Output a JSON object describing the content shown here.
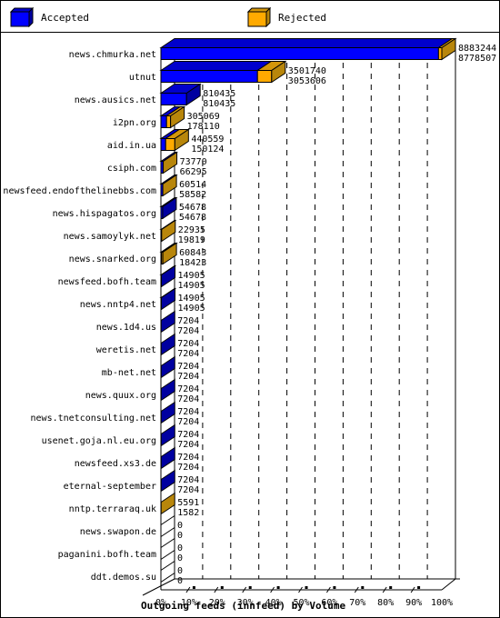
{
  "legend": [
    {
      "label": "Accepted",
      "color": "#0000ff",
      "shade": "#0000a0"
    },
    {
      "label": "Rejected",
      "color": "#ffaa00",
      "shade": "#b8860b"
    }
  ],
  "chart_data": {
    "type": "bar",
    "orientation": "horizontal",
    "stacked": true,
    "title": "Outgoing feeds (innfeed) by Volume",
    "xlabel": "",
    "ylabel": "",
    "xlim": [
      0,
      100
    ],
    "x_unit": "percent of max offered",
    "grid": true,
    "legend_position": "top",
    "x_tick_labels": [
      "0%",
      "10%",
      "20%",
      "30%",
      "40%",
      "50%",
      "60%",
      "70%",
      "80%",
      "90%",
      "100%"
    ],
    "categories": [
      "news.chmurka.net",
      "utnut",
      "news.ausics.net",
      "i2pn.org",
      "aid.in.ua",
      "csiph.com",
      "newsfeed.endofthelinebbs.com",
      "news.hispagatos.org",
      "news.samoylyk.net",
      "news.snarked.org",
      "newsfeed.bofh.team",
      "news.nntp4.net",
      "news.1d4.us",
      "weretis.net",
      "mb-net.net",
      "news.quux.org",
      "news.tnetconsulting.net",
      "usenet.goja.nl.eu.org",
      "newsfeed.xs3.de",
      "eternal-september",
      "nntp.terraraq.uk",
      "news.swapon.de",
      "paganini.bofh.team",
      "ddt.demos.su"
    ],
    "offered": [
      8883244,
      3501740,
      810435,
      305069,
      440559,
      73770,
      60514,
      54678,
      22935,
      60843,
      14905,
      14905,
      7204,
      7204,
      7204,
      7204,
      7204,
      7204,
      7204,
      7204,
      5591,
      0,
      0,
      0
    ],
    "accepted": [
      8778507,
      3053606,
      810435,
      178110,
      150124,
      66295,
      58582,
      54678,
      19819,
      18423,
      14905,
      14905,
      7204,
      7204,
      7204,
      7204,
      7204,
      7204,
      7204,
      7204,
      1582,
      0,
      0,
      0
    ],
    "series": [
      {
        "name": "Accepted",
        "color": "#0000ff"
      },
      {
        "name": "Rejected",
        "color": "#ffaa00"
      }
    ]
  }
}
